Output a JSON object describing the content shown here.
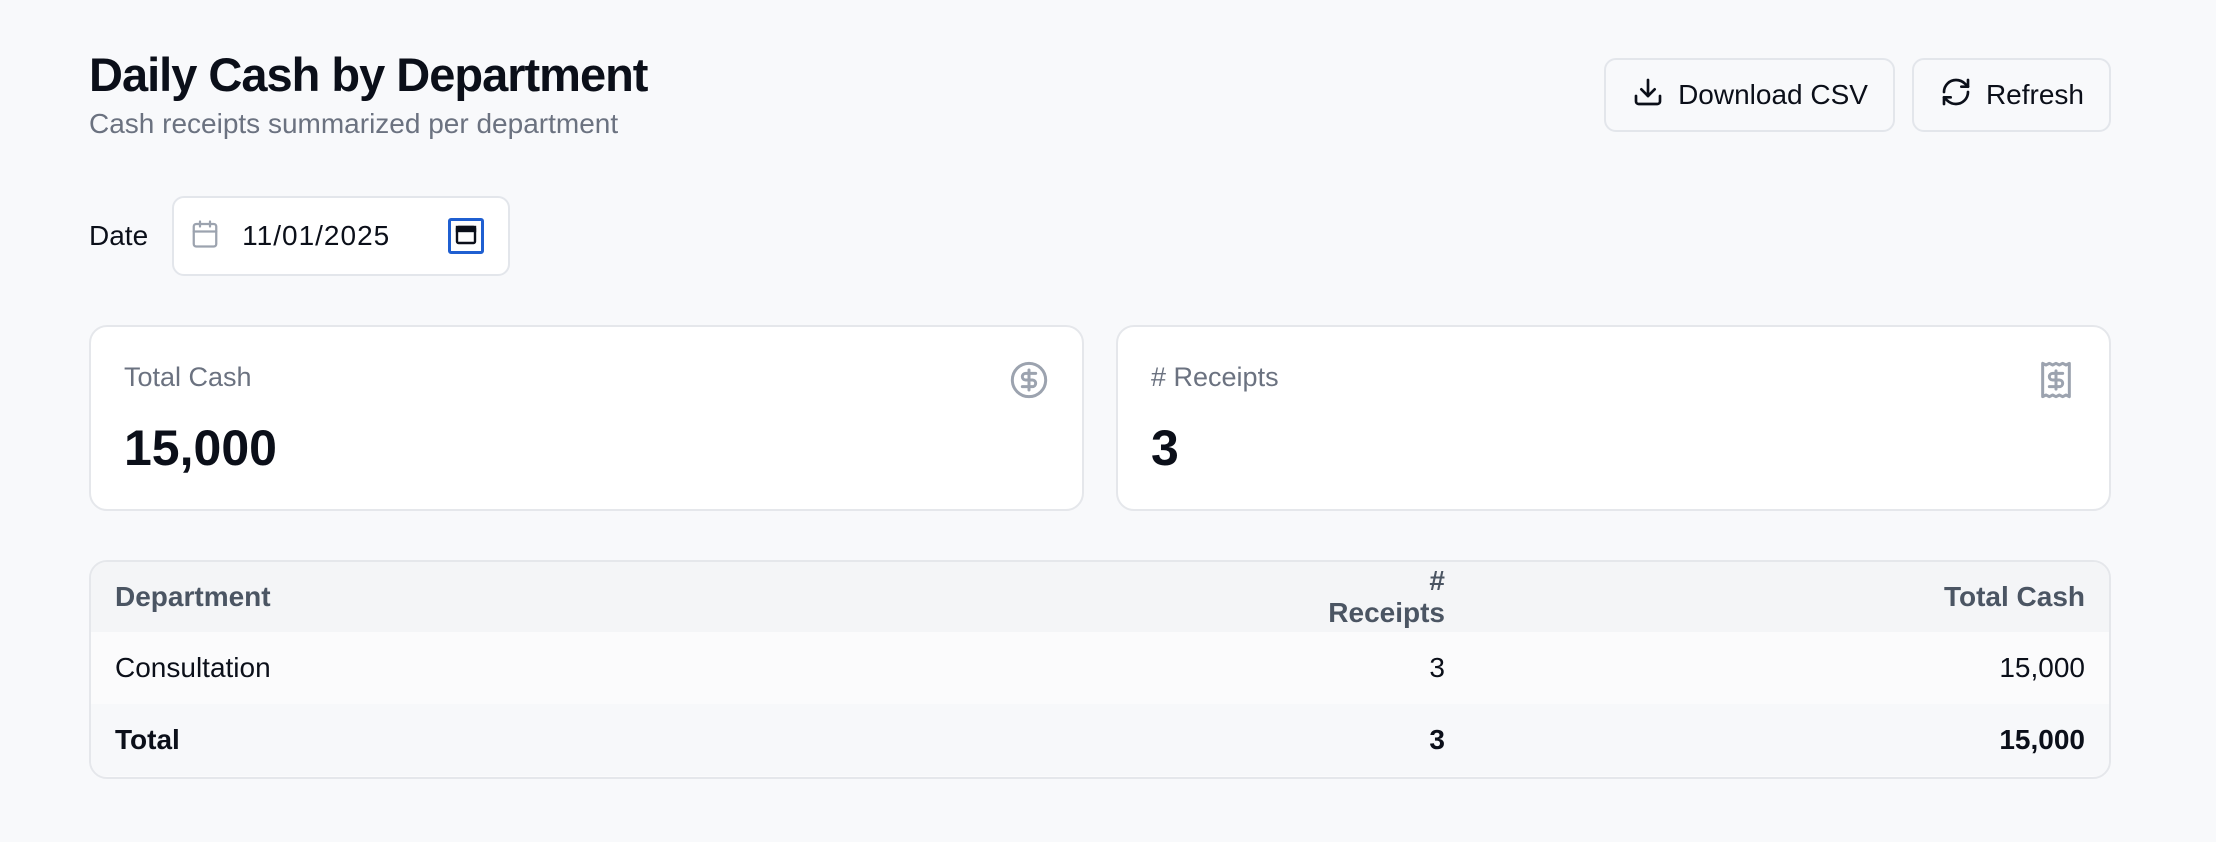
{
  "header": {
    "title": "Daily Cash by Department",
    "subtitle": "Cash receipts summarized per department"
  },
  "actions": {
    "download_label": "Download CSV",
    "refresh_label": "Refresh"
  },
  "filters": {
    "date_label": "Date",
    "date_value": "11/01/2025"
  },
  "summary": {
    "total_cash_label": "Total Cash",
    "total_cash_value": "15,000",
    "total_cash_icon": "dollar-circle-icon",
    "receipts_label": "# Receipts",
    "receipts_value": "3",
    "receipts_icon": "receipt-icon"
  },
  "table": {
    "headers": [
      "Department",
      "# Receipts",
      "Total Cash"
    ],
    "rows": [
      [
        "Consultation",
        "3",
        "15,000"
      ]
    ],
    "total": [
      "Total",
      "3",
      "15,000"
    ]
  },
  "colors": {
    "accent_focus": "#1f5fd1",
    "muted_text": "#6b7280",
    "border": "#e5e7eb"
  }
}
